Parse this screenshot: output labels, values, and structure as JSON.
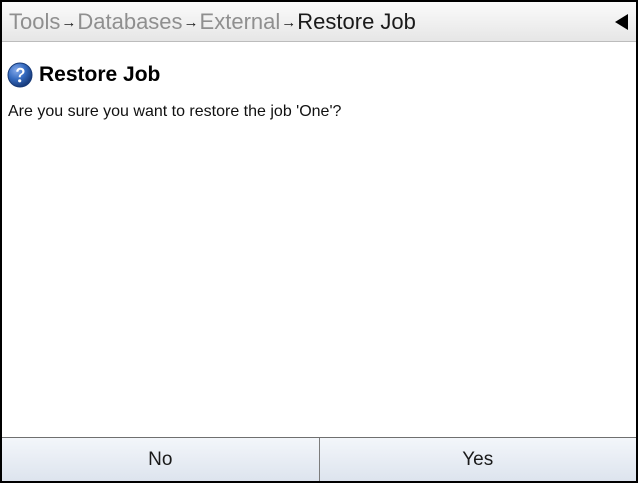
{
  "header": {
    "breadcrumb": [
      {
        "label": "Tools"
      },
      {
        "label": "Databases"
      },
      {
        "label": "External"
      },
      {
        "label": "Restore Job"
      }
    ],
    "separator": "→",
    "back_icon": "back-arrow-icon"
  },
  "dialog": {
    "icon": "help-icon",
    "title": "Restore Job",
    "message": "Are you sure you want to restore the job 'One'?"
  },
  "buttons": {
    "no_label": "No",
    "yes_label": "Yes"
  },
  "colors": {
    "breadcrumb_link": "#8f8f8f",
    "breadcrumb_current": "#1a1a1a",
    "help_icon": "#2f63b7",
    "button_background": "#e9eef5"
  }
}
